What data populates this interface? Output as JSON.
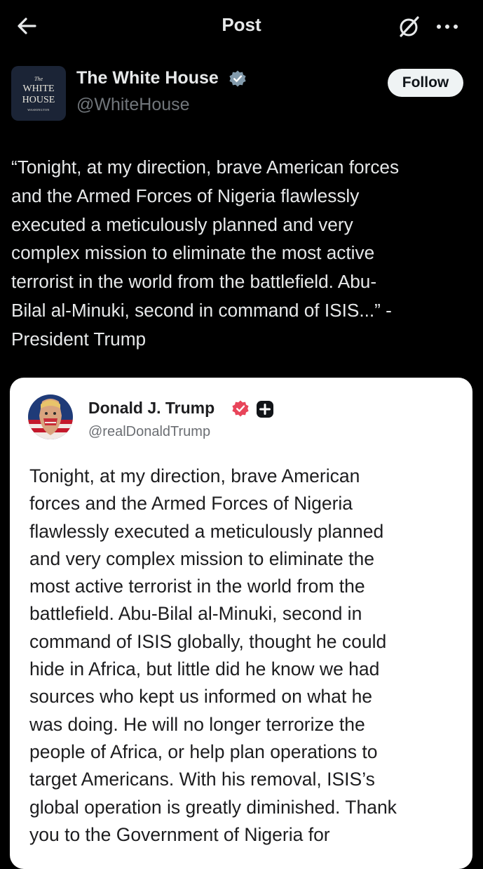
{
  "topbar": {
    "title": "Post",
    "back_icon": "arrow-left-icon",
    "grok_icon": "grok-icon",
    "more_icon": "more-horizontal-icon"
  },
  "author": {
    "name": "The White House",
    "handle": "@WhiteHouse",
    "verified_icon": "verified-badge-icon",
    "follow_label": "Follow",
    "avatar_logo": {
      "line1": "The",
      "line2": "WHITE",
      "line3": "HOUSE",
      "line4": "WASHINGTON"
    }
  },
  "post": {
    "lines": [
      "“Tonight, at my direction, brave American forces",
      "and the Armed Forces of Nigeria flawlessly",
      "executed a meticulously planned and very",
      "complex mission to eliminate the most active",
      "terrorist in the world from the battlefield. Abu-",
      "Bilal al-Minuki, second in command of ISIS...” -",
      "President Trump"
    ]
  },
  "quoted": {
    "name": "Donald J. Trump",
    "handle": "@realDonaldTrump",
    "verified_icon": "verified-badge-icon",
    "plus_icon": "plus-badge-icon",
    "lines": [
      "Tonight, at my direction, brave American",
      "forces and the Armed Forces of Nigeria",
      "flawlessly executed a meticulously planned",
      "and very complex mission to eliminate the",
      "most active terrorist in the world from the",
      "battlefield. Abu-Bilal al-Minuki, second in",
      "command of ISIS globally, thought he could",
      "hide in Africa, but little did he know we had",
      "sources who kept us informed on what he",
      "was doing. He will no longer terrorize the",
      "people of Africa, or help plan operations to",
      "target Americans. With his removal, ISIS’s",
      "global operation is greatly diminished. Thank",
      "you to the Government of Nigeria for"
    ]
  },
  "colors": {
    "background": "#000000",
    "text_primary": "#e7e9ea",
    "text_secondary": "#71767b",
    "verified_gray": "#829aab",
    "verified_red": "#e8455a",
    "card_background": "#ffffff"
  }
}
